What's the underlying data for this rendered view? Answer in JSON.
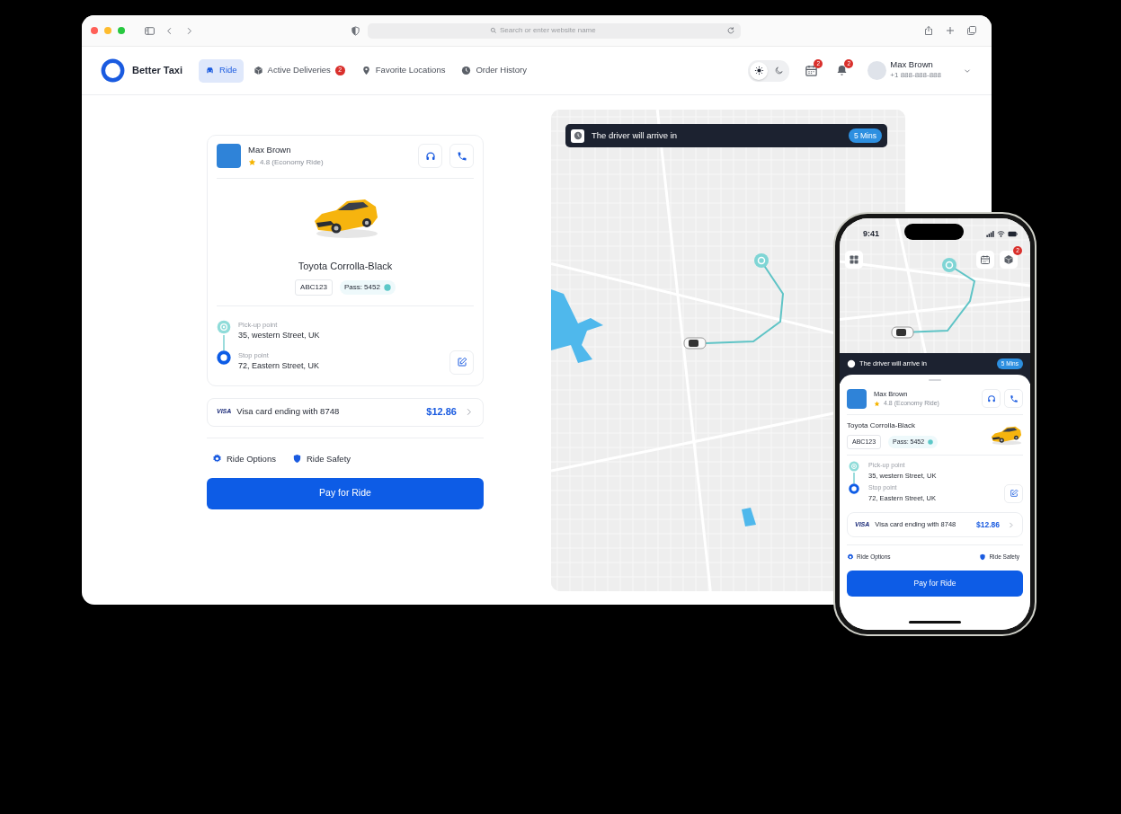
{
  "browser": {
    "address_placeholder": "Search or enter website name"
  },
  "header": {
    "brand": "Better Taxi",
    "nav": [
      {
        "kind": "car",
        "label": "Ride",
        "selected": true
      },
      {
        "kind": "box",
        "label": "Active Deliveries",
        "selected": false,
        "badge": "2"
      },
      {
        "kind": "pin",
        "label": "Favorite Locations",
        "selected": false
      },
      {
        "kind": "clock",
        "label": "Order History",
        "selected": false
      }
    ],
    "theme": [
      {
        "kind": "sun",
        "selected": true
      },
      {
        "kind": "moon",
        "selected": false
      }
    ],
    "actions": [
      {
        "kind": "calendar",
        "badge": "2"
      },
      {
        "kind": "bell",
        "badge": "2"
      }
    ],
    "user": {
      "name": "Max Brown",
      "phone": "+1 888-888-888"
    }
  },
  "ride": {
    "driver": {
      "name": "Max Brown",
      "rating": "4.8 (Economy Ride)"
    },
    "car": {
      "model": "Toyota Corrolla-Black",
      "plate": "ABC123",
      "pass": "Pass: 5452"
    },
    "stops": [
      {
        "kind": "pickup",
        "label": "Pick-up point",
        "address": "35, western Street, UK"
      },
      {
        "kind": "stop",
        "label": "Stop point",
        "address": "72, Eastern Street, UK"
      }
    ],
    "payment": {
      "brand": "VISA",
      "card": "Visa card ending with 8748",
      "amount": "$12.86"
    },
    "options": [
      {
        "kind": "gear",
        "label": "Ride Options"
      },
      {
        "kind": "shield",
        "label": "Ride Safety"
      }
    ],
    "pay_button": "Pay for Ride"
  },
  "map": {
    "eta_label": "The driver will arrive in",
    "eta": "5 Mins"
  },
  "phone": {
    "time": "9:41",
    "actions": [
      {
        "kind": "calendar"
      },
      {
        "kind": "box",
        "badge": "2"
      }
    ],
    "eta_label": "The driver will arrive in",
    "eta": "5 Mins",
    "ride": {
      "driver": {
        "name": "Max Brown",
        "rating": "4.8 (Economy Ride)"
      },
      "car": {
        "model": "Toyota Corrolla-Black",
        "plate": "ABC123",
        "pass": "Pass: 5452"
      },
      "stops": [
        {
          "kind": "pickup",
          "label": "Pick-up point",
          "address": "35, western Street, UK"
        },
        {
          "kind": "stop",
          "label": "Stop point",
          "address": "72, Eastern Street, UK"
        }
      ],
      "payment": {
        "brand": "VISA",
        "card": "Visa card ending with 8748",
        "amount": "$12.86"
      },
      "options": [
        {
          "kind": "gear",
          "label": "Ride Options"
        },
        {
          "kind": "shield",
          "label": "Ride Safety"
        }
      ],
      "pay_button": "Pay for Ride"
    }
  }
}
